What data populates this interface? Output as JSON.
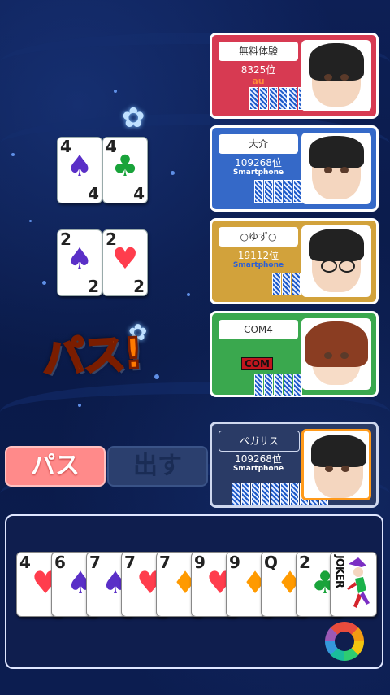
{
  "colors": {
    "panel_red": "#d73a52",
    "panel_blue": "#3569c8",
    "panel_gold": "#d2a23b",
    "panel_green": "#3aa84e",
    "panel_dark": "#2a3b66"
  },
  "played": {
    "row1": [
      {
        "rank": "4",
        "suit": "♠",
        "color": "#5a2fc7"
      },
      {
        "rank": "4",
        "suit": "♣",
        "color": "#19a33a"
      }
    ],
    "row2": [
      {
        "rank": "2",
        "suit": "♠",
        "color": "#5a2fc7"
      },
      {
        "rank": "2",
        "suit": "♥",
        "color": "#ff3d4d"
      }
    ]
  },
  "pass_label": "パス!",
  "players": [
    {
      "name": "無料体験",
      "rank": "8325位",
      "device": "au"
    },
    {
      "name": "大介",
      "rank": "109268位",
      "device": "Smartphone"
    },
    {
      "name": "○ゆず○",
      "rank": "19112位",
      "device": "Smartphone"
    },
    {
      "name": "COM4",
      "badge": "COM"
    },
    {
      "name": "ペガサス",
      "rank": "109268位",
      "device": "Smartphone"
    }
  ],
  "actions": {
    "pass": "パス",
    "play": "出す"
  },
  "hand": [
    {
      "rank": "4",
      "suit": "♥",
      "color": "#ff3d4d"
    },
    {
      "rank": "6",
      "suit": "♠",
      "color": "#5a2fc7"
    },
    {
      "rank": "7",
      "suit": "♠",
      "color": "#5a2fc7"
    },
    {
      "rank": "7",
      "suit": "♥",
      "color": "#ff3d4d"
    },
    {
      "rank": "7",
      "suit": "♦",
      "color": "#ff9a00"
    },
    {
      "rank": "9",
      "suit": "♥",
      "color": "#ff3d4d"
    },
    {
      "rank": "9",
      "suit": "♦",
      "color": "#ff9a00"
    },
    {
      "rank": "Q",
      "suit": "♦",
      "color": "#ff9a00"
    },
    {
      "rank": "2",
      "suit": "♣",
      "color": "#19a33a"
    },
    {
      "rank": "JOKER",
      "suit": "",
      "color": "#111"
    }
  ]
}
